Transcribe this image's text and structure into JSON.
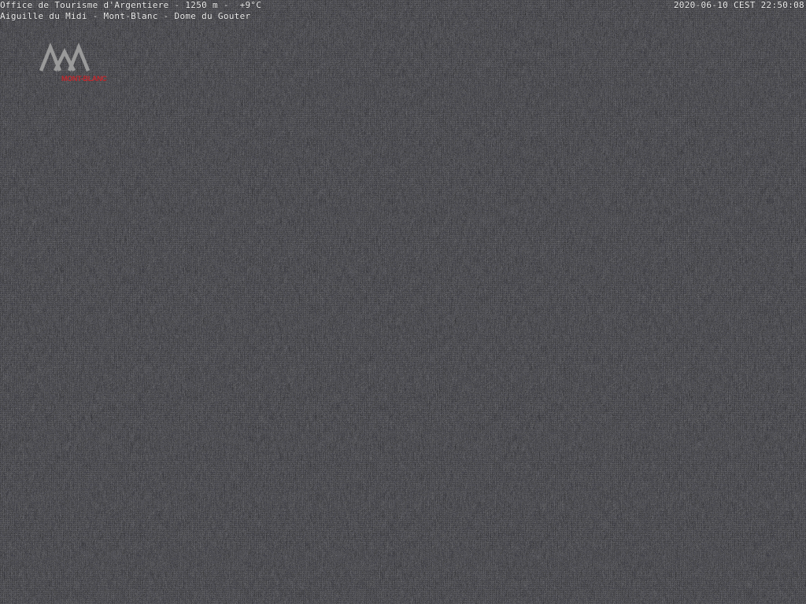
{
  "overlay": {
    "line1": "Office de Tourisme d'Argentiere - 1250 m -  +9°C",
    "line2": "Aiguille du Midi - Mont-Blanc - Dome du Gouter",
    "timestamp": "2020-06-10 CEST 22:50:08"
  },
  "logo": {
    "text": "MONT-BLANC",
    "icon": "mountain-peaks-icon",
    "peak_color": "#9a9a9a",
    "text_color": "#c0282d"
  },
  "colors": {
    "background": "#151515",
    "overlay_text": "#f2f2f2"
  }
}
